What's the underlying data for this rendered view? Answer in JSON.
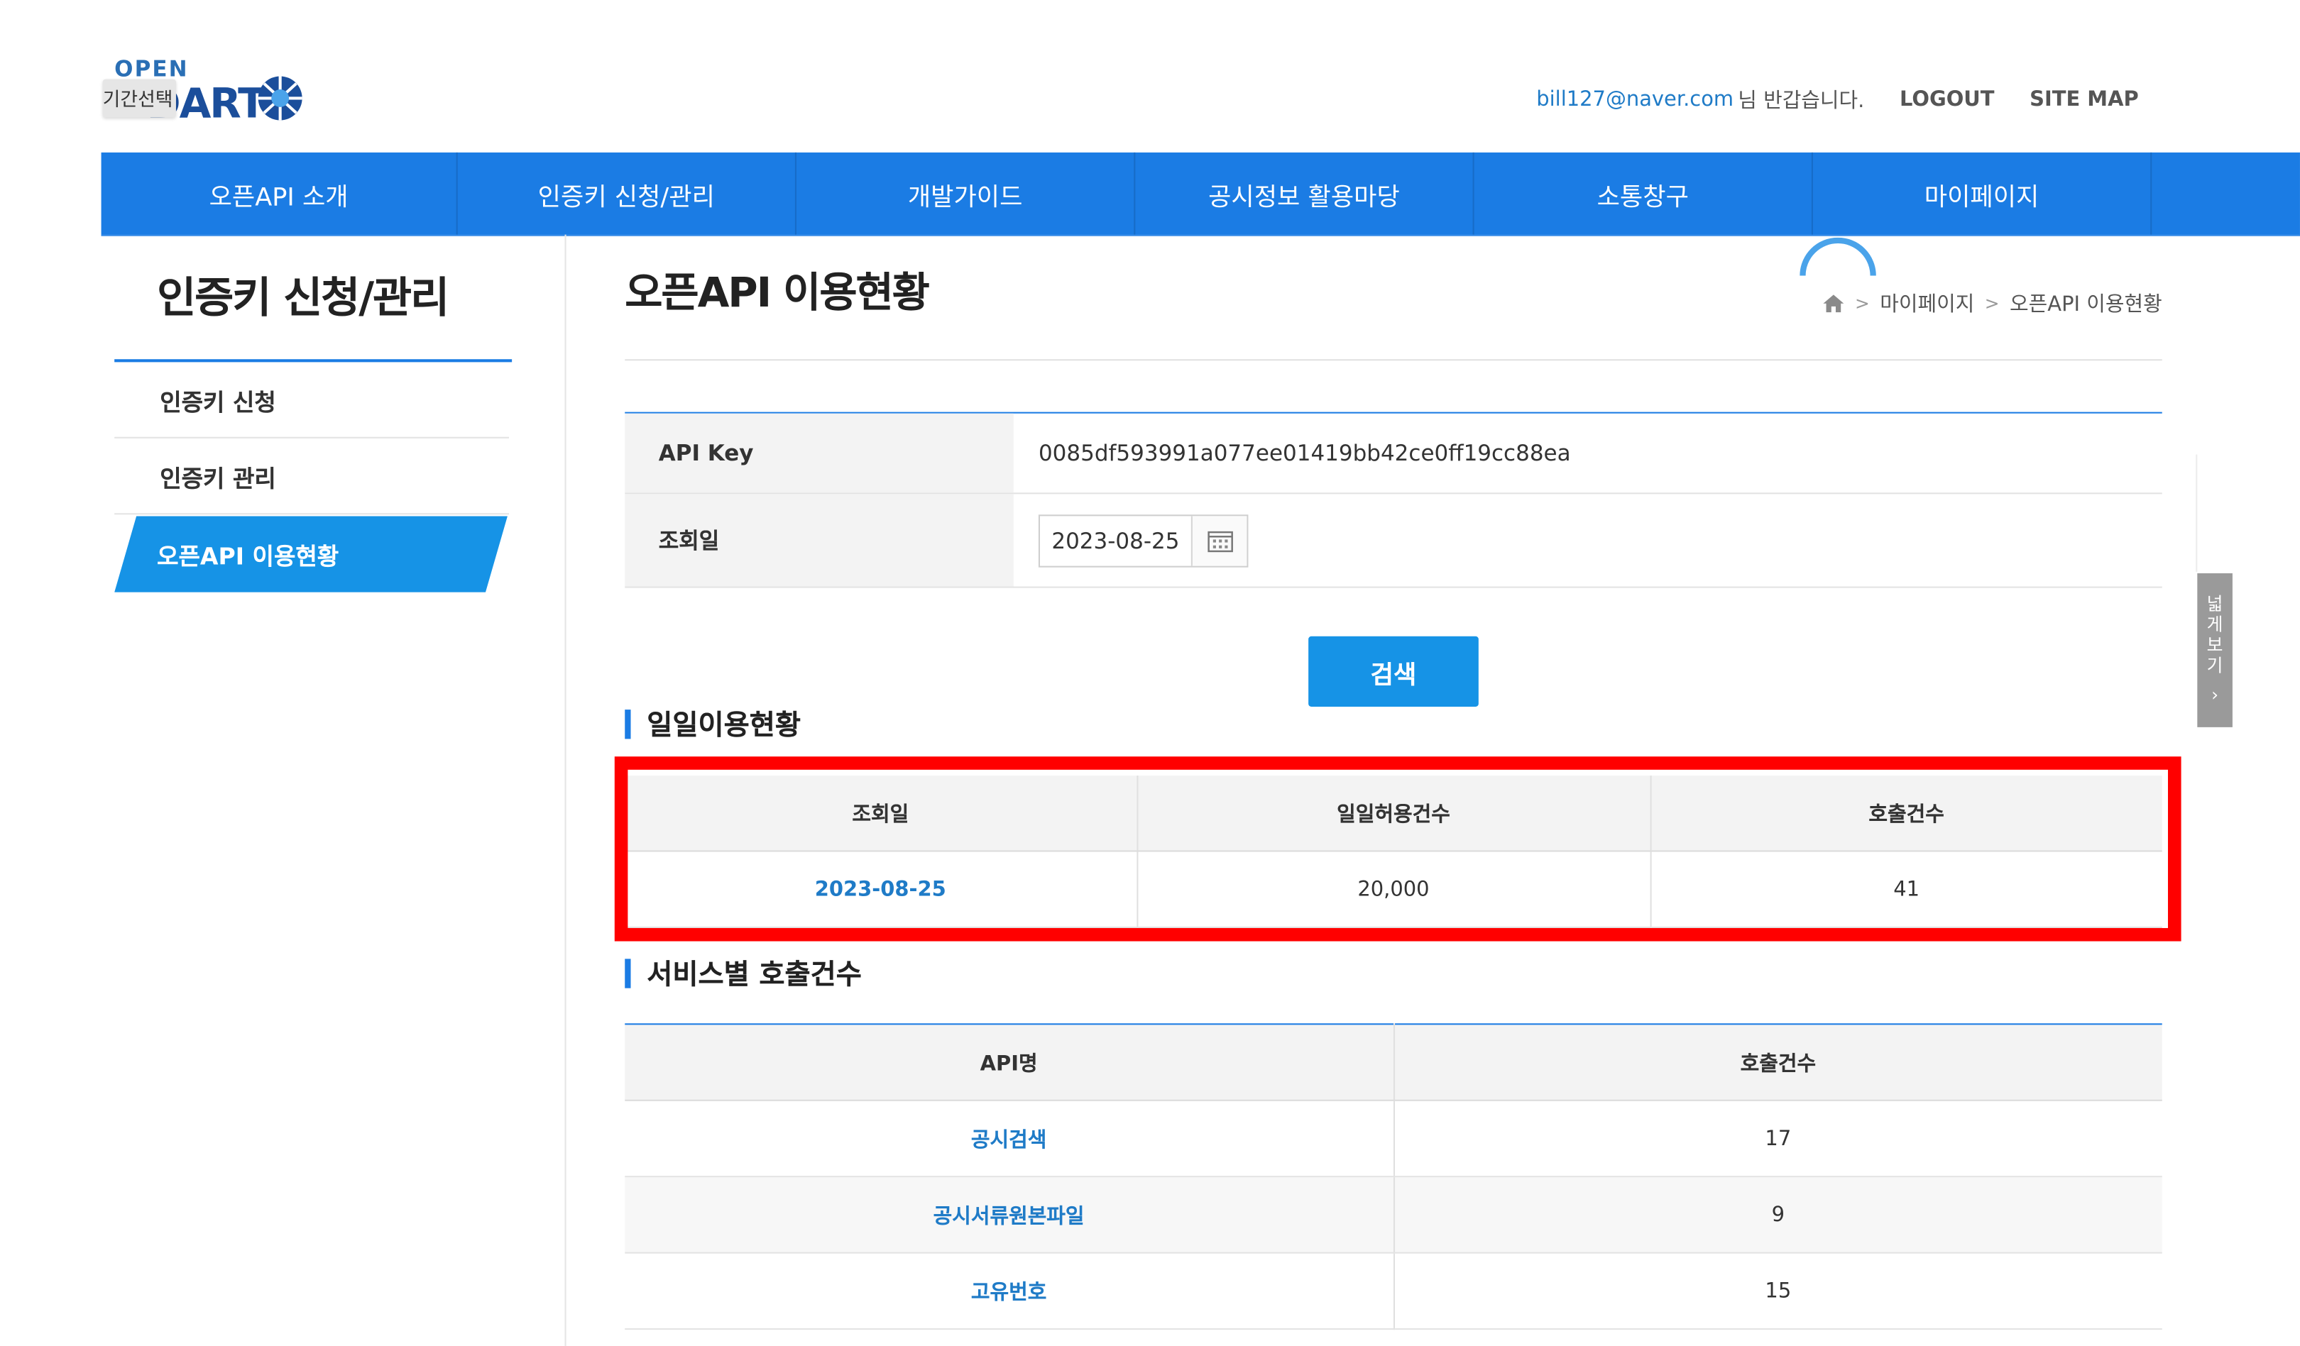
{
  "logo": {
    "top": "OPEN",
    "bottom": "DART",
    "tooltip": "기간선택"
  },
  "util": {
    "email": "bill127@naver.com",
    "suffix": "님 반갑습니다.",
    "logout": "LOGOUT",
    "sitemap": "SITE MAP"
  },
  "gnb": [
    {
      "label": "오픈API 소개"
    },
    {
      "label": "인증키 신청/관리"
    },
    {
      "label": "개발가이드"
    },
    {
      "label": "공시정보 활용마당"
    },
    {
      "label": "소통창구"
    },
    {
      "label": "마이페이지"
    }
  ],
  "sidebar": {
    "title": "인증키 신청/관리",
    "items": [
      {
        "label": "인증키 신청"
      },
      {
        "label": "인증키 관리"
      },
      {
        "label": "오픈API 이용현황"
      }
    ]
  },
  "page": {
    "title": "오픈API 이용현황",
    "breadcrumb": [
      "마이페이지",
      "오픈API 이용현황"
    ]
  },
  "form": {
    "api_key_label": "API Key",
    "api_key_value": "0085df593991a077ee01419bb42ce0ff19cc88ea",
    "date_label": "조회일",
    "date_value": "2023-08-25",
    "search": "검색"
  },
  "daily": {
    "title": "일일이용현황",
    "headers": [
      "조회일",
      "일일허용건수",
      "호출건수"
    ],
    "row": [
      "2023-08-25",
      "20,000",
      "41"
    ]
  },
  "service": {
    "title": "서비스별 호출건수",
    "headers": [
      "API명",
      "호출건수"
    ],
    "rows": [
      [
        "공시검색",
        "17"
      ],
      [
        "공시서류원본파일",
        "9"
      ],
      [
        "고유번호",
        "15"
      ]
    ]
  },
  "wide_view": {
    "label": [
      "넓",
      "게",
      "보",
      "기"
    ],
    "arrow": "›"
  },
  "colors": {
    "primary": "#1b7ce4",
    "button": "#1693e6",
    "link": "#1f7bc7",
    "highlight": "#ff0000"
  }
}
